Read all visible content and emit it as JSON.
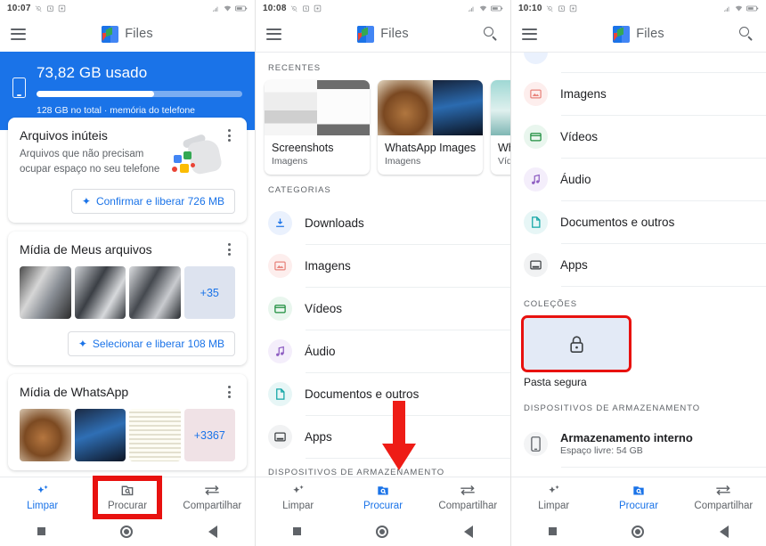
{
  "app": {
    "name": "Files",
    "logo_icon": "files-logo-icon"
  },
  "panels": [
    {
      "id": "panel-home",
      "status": {
        "time": "10:07",
        "icons": [
          "alarm-off-icon",
          "alarm-clock-icon",
          "screenshot-icon"
        ],
        "right_icons": [
          "signal-icon",
          "wifi-icon",
          "battery-icon"
        ]
      },
      "appbar": {
        "menu_icon": "hamburger-icon",
        "title": "Files",
        "search_icon": null
      },
      "storage": {
        "used_label": "73,82 GB usado",
        "sub_label": "128 GB no total · memória do telefone",
        "percent": 57,
        "device_icon": "phone-icon",
        "accent": "#1a73e8"
      },
      "cards": [
        {
          "title": "Arquivos inúteis",
          "subtitle": "Arquivos que não precisam ocupar espaço no seu telefone",
          "cta": "Confirmar e liberar 726 MB",
          "menu_icon": "more-vert-icon",
          "art": "junk-bag-icon"
        },
        {
          "title": "Mídia de Meus arquivos",
          "cta": "Selecionar e liberar 108 MB",
          "menu_icon": "more-vert-icon",
          "overflow_count": "+35"
        },
        {
          "title": "Mídia de WhatsApp",
          "menu_icon": "more-vert-icon",
          "overflow_count": "+3367"
        }
      ],
      "bottom_nav": {
        "items": [
          {
            "label": "Limpar",
            "icon": "sparkle-icon",
            "active": true,
            "highlighted": false
          },
          {
            "label": "Procurar",
            "icon": "folder-search-icon",
            "active": false,
            "highlighted": true
          },
          {
            "label": "Compartilhar",
            "icon": "share-arrows-icon",
            "active": false,
            "highlighted": false
          }
        ]
      }
    },
    {
      "id": "panel-browse",
      "status": {
        "time": "10:08",
        "icons": [
          "alarm-off-icon",
          "alarm-clock-icon",
          "screenshot-icon"
        ],
        "right_icons": [
          "signal-icon",
          "wifi-icon",
          "battery-icon"
        ]
      },
      "appbar": {
        "menu_icon": "hamburger-icon",
        "title": "Files",
        "search_icon": "search-icon"
      },
      "recents": {
        "section_label": "RECENTES",
        "items": [
          {
            "name": "Screenshots",
            "type": "Imagens"
          },
          {
            "name": "WhatsApp Images",
            "type": "Imagens"
          },
          {
            "name": "WhatsApp An",
            "type": "Vídeos"
          }
        ]
      },
      "categories": {
        "section_label": "CATEGORIAS",
        "items": [
          {
            "label": "Downloads",
            "icon": "download-icon",
            "color": "#1a73e8"
          },
          {
            "label": "Imagens",
            "icon": "image-icon",
            "color": "#e8847c"
          },
          {
            "label": "Vídeos",
            "icon": "video-icon",
            "color": "#1e8e3e"
          },
          {
            "label": "Áudio",
            "icon": "audio-note-icon",
            "color": "#8e5ec2"
          },
          {
            "label": "Documentos e outros",
            "icon": "document-icon",
            "color": "#12a5a5"
          },
          {
            "label": "Apps",
            "icon": "apps-box-icon",
            "color": "#3c4043"
          }
        ]
      },
      "storage_devices": {
        "section_label": "DISPOSITIVOS DE ARMAZENAMENTO"
      },
      "annotation": {
        "arrow_icon": "red-down-arrow-icon",
        "color": "#ee1c16"
      },
      "bottom_nav": {
        "items": [
          {
            "label": "Limpar",
            "icon": "sparkle-icon",
            "active": false,
            "highlighted": false
          },
          {
            "label": "Procurar",
            "icon": "folder-search-icon",
            "active": true,
            "highlighted": false
          },
          {
            "label": "Compartilhar",
            "icon": "share-arrows-icon",
            "active": false,
            "highlighted": false
          }
        ]
      }
    },
    {
      "id": "panel-browse-scrolled",
      "status": {
        "time": "10:10",
        "icons": [
          "alarm-off-icon",
          "alarm-clock-icon",
          "screenshot-icon"
        ],
        "right_icons": [
          "signal-icon",
          "wifi-icon",
          "battery-icon"
        ]
      },
      "appbar": {
        "menu_icon": "hamburger-icon",
        "title": "Files",
        "search_icon": "search-icon"
      },
      "categories": {
        "items": [
          {
            "label": "Imagens",
            "icon": "image-icon",
            "color": "#e8847c"
          },
          {
            "label": "Vídeos",
            "icon": "video-icon",
            "color": "#1e8e3e"
          },
          {
            "label": "Áudio",
            "icon": "audio-note-icon",
            "color": "#8e5ec2"
          },
          {
            "label": "Documentos e outros",
            "icon": "document-icon",
            "color": "#12a5a5"
          },
          {
            "label": "Apps",
            "icon": "apps-box-icon",
            "color": "#3c4043"
          }
        ]
      },
      "collections": {
        "section_label": "COLEÇÕES",
        "safe_folder": {
          "label": "Pasta segura",
          "icon": "lock-icon",
          "highlighted": true
        }
      },
      "storage_devices": {
        "section_label": "DISPOSITIVOS DE ARMAZENAMENTO",
        "items": [
          {
            "label": "Armazenamento interno",
            "sublabel": "Espaço livre: 54 GB",
            "icon": "phone-storage-icon"
          }
        ]
      },
      "bottom_nav": {
        "items": [
          {
            "label": "Limpar",
            "icon": "sparkle-icon",
            "active": false,
            "highlighted": false
          },
          {
            "label": "Procurar",
            "icon": "folder-search-icon",
            "active": true,
            "highlighted": false
          },
          {
            "label": "Compartilhar",
            "icon": "share-arrows-icon",
            "active": false,
            "highlighted": false
          }
        ]
      }
    }
  ],
  "system_nav": {
    "recents_icon": "square-icon",
    "home_icon": "circle-icon",
    "back_icon": "triangle-back-icon"
  },
  "colors": {
    "accent": "#1a73e8",
    "highlight": "#e8110f",
    "text_primary": "#202124",
    "text_secondary": "#5f6368"
  }
}
